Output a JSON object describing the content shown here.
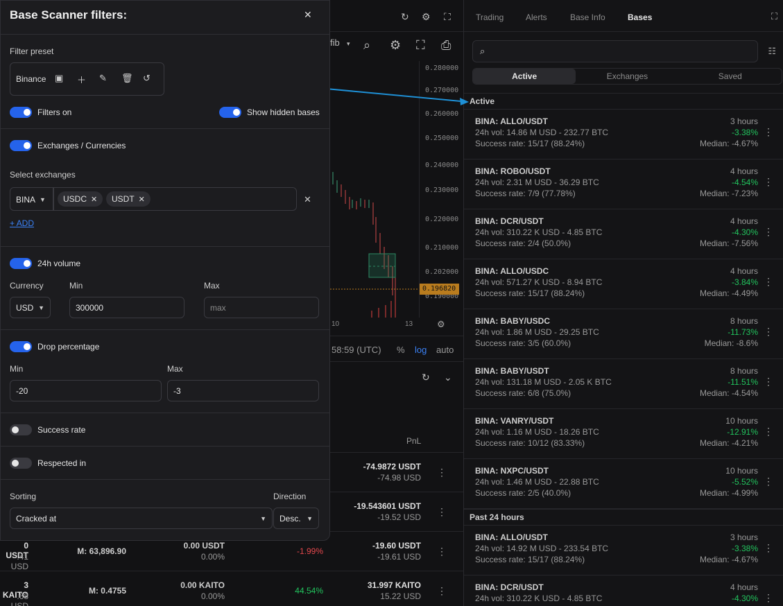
{
  "chart": {
    "fib_label": "fib",
    "price_ticks": [
      "0.280000",
      "0.270000",
      "0.260000",
      "0.250000",
      "0.240000",
      "0.230000",
      "0.220000",
      "0.210000",
      "0.202000",
      "0.196820",
      "0.190000"
    ],
    "last_price": "0.196820",
    "date_ticks": [
      "10",
      "13"
    ],
    "time_label": "58:59 (UTC)",
    "pct_label": "%",
    "log_label": "log",
    "auto_label": "auto"
  },
  "positions": {
    "pnl_header": "PnL",
    "rows": [
      {
        "pnl": "-74.9872 USDT",
        "pnl_usd": "-74.98 USD"
      },
      {
        "pnl": "-19.543601 USDT",
        "pnl_usd": "-19.52 USD"
      },
      {
        "amount": "0 USDT",
        "amount_usd": ".41 USD",
        "median": "M: 63,896.90",
        "fee": "0.00 USDT",
        "fee_pct": "0.00%",
        "change": "-1.99%",
        "pnl": "-19.60 USDT",
        "pnl_usd": "-19.61 USD"
      },
      {
        "amount": "3 KAITO",
        "amount_usd": ".68 USD",
        "median": "M: 0.4755",
        "fee": "0.00 KAITO",
        "fee_pct": "0.00%",
        "change": "44.54%",
        "pnl": "31.997 KAITO",
        "pnl_usd": "15.22 USD"
      }
    ]
  },
  "bases": {
    "tabs": [
      "Trading",
      "Alerts",
      "Base Info",
      "Bases"
    ],
    "active_tab": "Bases",
    "search": {
      "value": "",
      "placeholder": ""
    },
    "segments": [
      "Active",
      "Exchanges",
      "Saved"
    ],
    "active_segment": "Active",
    "groups": [
      {
        "title": "Active",
        "items": [
          {
            "name": "BINA: ALLO/USDT",
            "vol": "24h vol: 14.86 M USD - 232.77 BTC",
            "success": "Success rate: 15/17 (88.24%)",
            "time": "3 hours",
            "pct": "-3.38%",
            "median": "Median: -4.67%"
          },
          {
            "name": "BINA: ROBO/USDT",
            "vol": "24h vol: 2.31 M USD - 36.29 BTC",
            "success": "Success rate: 7/9 (77.78%)",
            "time": "4 hours",
            "pct": "-4.54%",
            "median": "Median: -7.23%"
          },
          {
            "name": "BINA: DCR/USDT",
            "vol": "24h vol: 310.22 K USD - 4.85 BTC",
            "success": "Success rate: 2/4 (50.0%)",
            "time": "4 hours",
            "pct": "-4.30%",
            "median": "Median: -7.56%"
          },
          {
            "name": "BINA: ALLO/USDC",
            "vol": "24h vol: 571.27 K USD - 8.94 BTC",
            "success": "Success rate: 15/17 (88.24%)",
            "time": "4 hours",
            "pct": "-3.84%",
            "median": "Median: -4.49%"
          },
          {
            "name": "BINA: BABY/USDC",
            "vol": "24h vol: 1.86 M USD - 29.25 BTC",
            "success": "Success rate: 3/5 (60.0%)",
            "time": "8 hours",
            "pct": "-11.73%",
            "median": "Median: -8.6%"
          },
          {
            "name": "BINA: BABY/USDT",
            "vol": "24h vol: 131.18 M USD - 2.05 K BTC",
            "success": "Success rate: 6/8 (75.0%)",
            "time": "8 hours",
            "pct": "-11.51%",
            "median": "Median: -4.54%"
          },
          {
            "name": "BINA: VANRY/USDT",
            "vol": "24h vol: 1.16 M USD - 18.26 BTC",
            "success": "Success rate: 10/12 (83.33%)",
            "time": "10 hours",
            "pct": "-12.91%",
            "median": "Median: -4.21%"
          },
          {
            "name": "BINA: NXPC/USDT",
            "vol": "24h vol: 1.46 M USD - 22.88 BTC",
            "success": "Success rate: 2/5 (40.0%)",
            "time": "10 hours",
            "pct": "-5.52%",
            "median": "Median: -4.99%"
          }
        ]
      },
      {
        "title": "Past 24 hours",
        "items": [
          {
            "name": "BINA: ALLO/USDT",
            "vol": "24h vol: 14.92 M USD - 233.54 BTC",
            "success": "Success rate: 15/17 (88.24%)",
            "time": "3 hours",
            "pct": "-3.38%",
            "median": "Median: -4.67%"
          },
          {
            "name": "BINA: DCR/USDT",
            "vol": "24h vol: 310.22 K USD - 4.85 BTC",
            "success": "",
            "time": "4 hours",
            "pct": "-4.30%",
            "median": ""
          }
        ]
      }
    ]
  },
  "filters": {
    "title": "Base Scanner filters:",
    "preset_label": "Filter preset",
    "preset_name": "Binance",
    "filters_on_label": "Filters on",
    "show_hidden_label": "Show hidden bases",
    "exchanges_label": "Exchanges / Currencies",
    "select_exchanges_label": "Select exchanges",
    "exchange": "BINA",
    "currencies": [
      "USDC",
      "USDT"
    ],
    "add_label": "+ ADD",
    "volume_label": "24h volume",
    "currency_label": "Currency",
    "min_label": "Min",
    "max_label": "Max",
    "currency_value": "USD",
    "volume_min": "300000",
    "volume_max_placeholder": "max",
    "drop_label": "Drop percentage",
    "drop_min_label": "Min",
    "drop_max_label": "Max",
    "drop_min": "-20",
    "drop_max": "-3",
    "success_label": "Success rate",
    "respected_label": "Respected in",
    "sorting_label": "Sorting",
    "direction_label": "Direction",
    "sorting_value": "Cracked at",
    "direction_value": "Desc."
  },
  "colors": {
    "accent": "#2563eb",
    "positive": "#22c55e",
    "negative": "#e5484d",
    "arrow": "#1e90d6"
  }
}
